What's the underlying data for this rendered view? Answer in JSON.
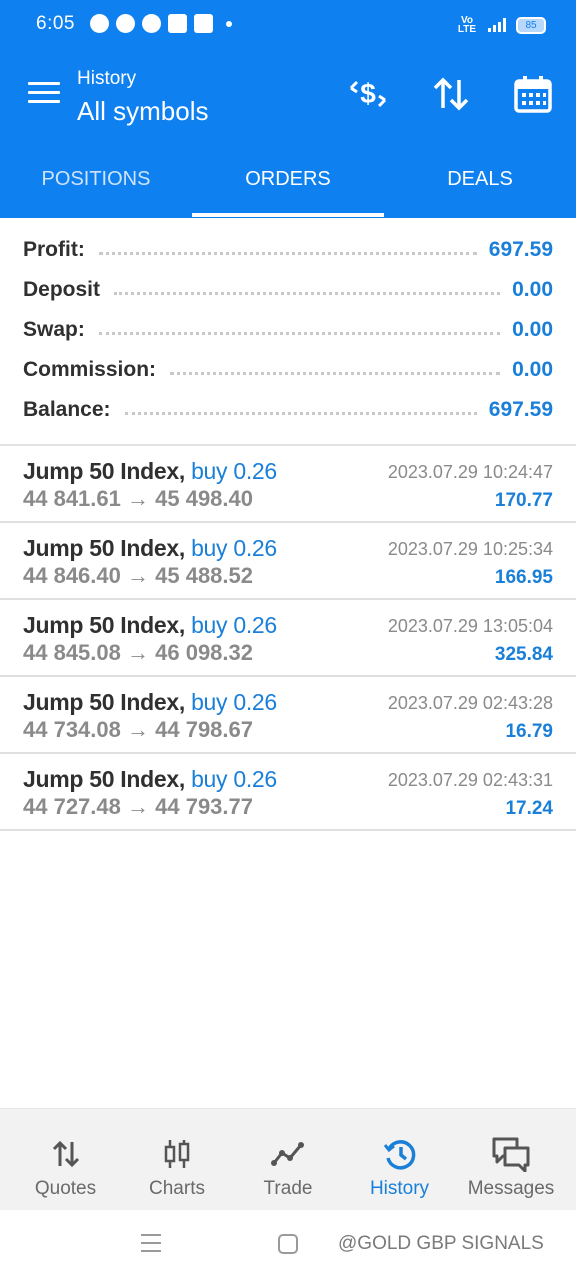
{
  "status_bar": {
    "time": "6:05",
    "network": "Vo LTE",
    "battery": "85"
  },
  "app_bar": {
    "subtitle": "History",
    "title": "All symbols",
    "icons": [
      "menu-icon",
      "deposit-dollar-icon",
      "sort-icon",
      "calendar-icon"
    ]
  },
  "tabs": [
    {
      "label": "POSITIONS",
      "active": false
    },
    {
      "label": "ORDERS",
      "active": true
    },
    {
      "label": "DEALS",
      "active": false
    }
  ],
  "summary": [
    {
      "label": "Profit:",
      "value": "697.59"
    },
    {
      "label": "Deposit",
      "value": "0.00"
    },
    {
      "label": "Swap:",
      "value": "0.00"
    },
    {
      "label": "Commission:",
      "value": "0.00"
    },
    {
      "label": "Balance:",
      "value": "697.59"
    }
  ],
  "deals": [
    {
      "symbol": "Jump 50 Index,",
      "side": "buy 0.26",
      "open_price": "44 841.61",
      "arrow": "→",
      "close_price": "45 498.40",
      "time": "2023.07.29 10:24:47",
      "profit": "170.77"
    },
    {
      "symbol": "Jump 50 Index,",
      "side": "buy 0.26",
      "open_price": "44 846.40",
      "arrow": "→",
      "close_price": "45 488.52",
      "time": "2023.07.29 10:25:34",
      "profit": "166.95"
    },
    {
      "symbol": "Jump 50 Index,",
      "side": "buy 0.26",
      "open_price": "44 845.08",
      "arrow": "→",
      "close_price": "46 098.32",
      "time": "2023.07.29 13:05:04",
      "profit": "325.84"
    },
    {
      "symbol": "Jump 50 Index,",
      "side": "buy 0.26",
      "open_price": "44 734.08",
      "arrow": "→",
      "close_price": "44 798.67",
      "time": "2023.07.29 02:43:28",
      "profit": "16.79"
    },
    {
      "symbol": "Jump 50 Index,",
      "side": "buy 0.26",
      "open_price": "44 727.48",
      "arrow": "→",
      "close_price": "44 793.77",
      "time": "2023.07.29 02:43:31",
      "profit": "17.24"
    }
  ],
  "bottom_nav": [
    {
      "label": "Quotes",
      "icon": "quotes-arrows-icon",
      "active": false
    },
    {
      "label": "Charts",
      "icon": "candlestick-icon",
      "active": false
    },
    {
      "label": "Trade",
      "icon": "trade-line-icon",
      "active": false
    },
    {
      "label": "History",
      "icon": "history-clock-icon",
      "active": true
    },
    {
      "label": "Messages",
      "icon": "messages-icon",
      "active": false
    }
  ],
  "watermark": "@GOLD GBP SIGNALS",
  "colors": {
    "primary": "#0f80f0",
    "accent_text": "#1a7fd8",
    "muted_text": "#8a8a8a"
  }
}
